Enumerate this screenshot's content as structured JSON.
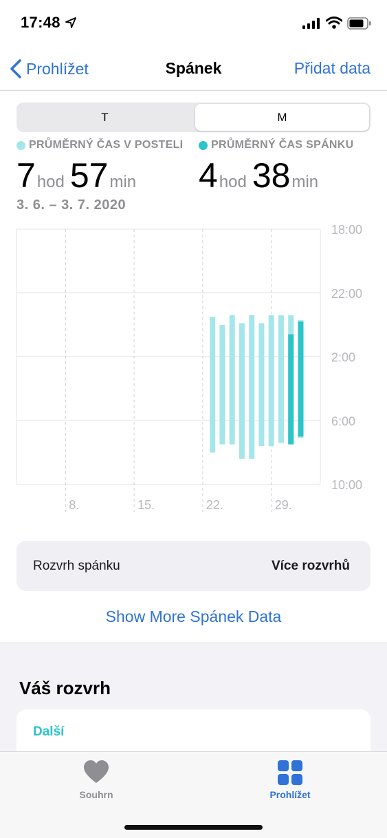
{
  "status_bar": {
    "time": "17:48"
  },
  "nav": {
    "back_label": "Prohlížet",
    "title": "Spánek",
    "action_label": "Přidat data"
  },
  "segments": {
    "left": "T",
    "right": "M",
    "selected": "M"
  },
  "stats": {
    "in_bed": {
      "label": "PRŮMĚRNÝ ČAS V POSTELI",
      "hours": "7",
      "hours_unit": "hod",
      "minutes": "57",
      "minutes_unit": "min",
      "color": "#a4e6e9"
    },
    "asleep": {
      "label": "PRŮMĚRNÝ ČAS SPÁNKU",
      "hours": "4",
      "hours_unit": "hod",
      "minutes": "38",
      "minutes_unit": "min",
      "color": "#2cc4c9"
    },
    "date_range": "3. 6. – 3. 7. 2020"
  },
  "chart_data": {
    "type": "bar",
    "y_tick_labels": [
      "18:00",
      "22:00",
      "2:00",
      "6:00",
      "10:00"
    ],
    "y_range_hours_since_18": [
      0,
      16
    ],
    "x_tick_labels": [
      "8.",
      "15.",
      "22.",
      "29."
    ],
    "x_tick_days": [
      8,
      15,
      22,
      29
    ],
    "day_range": [
      3,
      34
    ],
    "colors": {
      "in_bed": "#a4e6e9",
      "asleep": "#2cc4c9"
    },
    "in_bed": [
      {
        "day": 23,
        "start": 5.5,
        "end": 14.0
      },
      {
        "day": 24,
        "start": 6.0,
        "end": 13.5
      },
      {
        "day": 25,
        "start": 5.4,
        "end": 13.5
      },
      {
        "day": 26,
        "start": 5.9,
        "end": 14.4
      },
      {
        "day": 27,
        "start": 5.4,
        "end": 14.4
      },
      {
        "day": 28,
        "start": 5.9,
        "end": 13.6
      },
      {
        "day": 29,
        "start": 5.4,
        "end": 13.6
      },
      {
        "day": 30,
        "start": 5.4,
        "end": 13.4
      },
      {
        "day": 31,
        "start": 5.4,
        "end": 13.4
      },
      {
        "day": 32,
        "start": 5.7,
        "end": 13.1
      }
    ],
    "asleep": [
      {
        "day": 31,
        "start": 6.6,
        "end": 13.5
      },
      {
        "day": 32,
        "start": 5.8,
        "end": 13.0
      }
    ]
  },
  "schedule": {
    "label": "Rozvrh spánku",
    "more": "Více rozvrhů"
  },
  "show_more": "Show More Spánek Data",
  "your_schedule": {
    "title": "Váš rozvrh",
    "next_label": "Další"
  },
  "tabs": [
    {
      "label": "Souhrn",
      "icon": "heart-icon"
    },
    {
      "label": "Prohlížet",
      "icon": "grid-icon"
    }
  ]
}
